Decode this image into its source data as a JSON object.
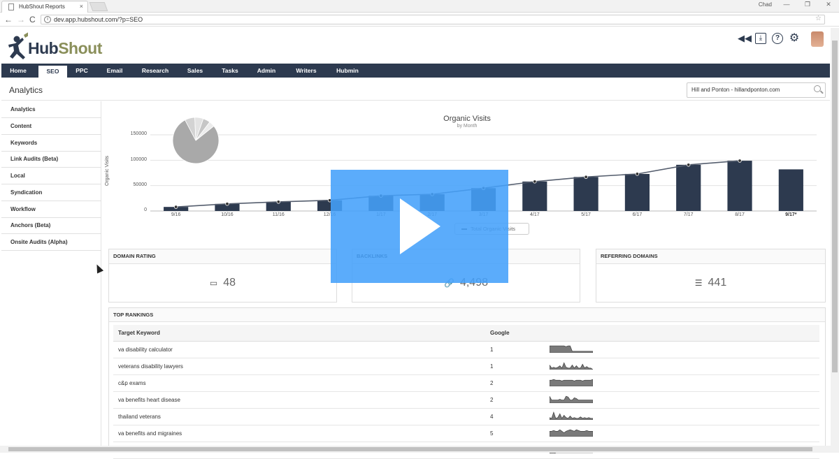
{
  "browser": {
    "tab_title": "HubShout Reports",
    "tab_close": "×",
    "user_badge": "Chad",
    "window_controls": [
      "—",
      "❐",
      "✕"
    ],
    "back_glyph": "←",
    "forward_glyph": "→",
    "reload_glyph": "C",
    "info_glyph": "i",
    "url": "dev.app.hubshout.com/?p=SEO",
    "star_glyph": "☆"
  },
  "app": {
    "logo_hub": "Hub",
    "logo_shout": "Shout",
    "header_icons": [
      "rewind-icon",
      "download-icon",
      "help-icon",
      "gear-icon"
    ],
    "header_glyphs": [
      "◀◀",
      "⤓",
      "?",
      "⚙"
    ]
  },
  "mainnav": [
    "Home",
    "SEO",
    "PPC",
    "Email",
    "Research",
    "Sales",
    "Tasks",
    "Admin",
    "Writers",
    "Hubmin"
  ],
  "mainnav_active": "SEO",
  "page": {
    "title": "Analytics",
    "site_search": "Hill and Ponton - hillandponton.com"
  },
  "sidebar": [
    "Analytics",
    "Content",
    "Keywords",
    "Link Audits (Beta)",
    "Local",
    "Syndication",
    "Workflow",
    "Anchors (Beta)",
    "Onsite Audits (Alpha)"
  ],
  "chart_data": {
    "type": "bar",
    "title": "Organic Visits",
    "subtitle": "by Month",
    "ylabel": "Organic Visits",
    "ylim": [
      0,
      150000
    ],
    "yticks": [
      "150000",
      "100000",
      "50000",
      "0"
    ],
    "categories": [
      "9/16",
      "10/16",
      "11/16",
      "12/16",
      "1/17",
      "2/17",
      "3/17",
      "4/17",
      "5/17",
      "6/17",
      "7/17",
      "8/17",
      "9/17*"
    ],
    "series": [
      {
        "values": [
          8000,
          14000,
          18000,
          21000,
          30000,
          33000,
          45000,
          58000,
          67000,
          73000,
          91000,
          99000,
          82000
        ]
      },
      {
        "name": "Total Organic Visits",
        "values": [
          8000,
          14000,
          18000,
          21000,
          30000,
          33000,
          45000,
          58000,
          67000,
          73000,
          91000,
          99000
        ]
      }
    ],
    "bar_color": "#2d3a4f",
    "line_color": "#555e6e",
    "grid": true
  },
  "pie": {
    "slices": [
      78,
      7,
      6,
      5,
      4
    ],
    "colors": [
      "#a9a9a9",
      "#d3d3d3",
      "#e3e3e3",
      "#c6c6c6",
      "#ececec"
    ]
  },
  "metrics": [
    {
      "label": "DOMAIN RATING",
      "icon": "battery-icon",
      "glyph": "▭",
      "value": "48"
    },
    {
      "label": "BACKLINKS",
      "icon": "link-icon",
      "glyph": "🔗",
      "value": "4,498"
    },
    {
      "label": "REFERRING DOMAINS",
      "icon": "lines-icon",
      "glyph": "☰",
      "value": "441"
    }
  ],
  "rankings": {
    "title": "TOP RANKINGS",
    "col_keyword": "Target Keyword",
    "col_google": "Google",
    "rows": [
      {
        "keyword": "va disability calculator",
        "google": "1",
        "spark": [
          9,
          9,
          9,
          9,
          9,
          9,
          9,
          9,
          8,
          9,
          9,
          2,
          2,
          2,
          2,
          2,
          2,
          2,
          2,
          2,
          2,
          2
        ]
      },
      {
        "keyword": "veterans disability lawyers",
        "google": "1",
        "spark": [
          6,
          2,
          3,
          2,
          3,
          5,
          2,
          9,
          3,
          2,
          2,
          6,
          2,
          5,
          2,
          2,
          7,
          2,
          4,
          2,
          2,
          0
        ]
      },
      {
        "keyword": "c&p exams",
        "google": "2",
        "spark": [
          8,
          8,
          9,
          8,
          8,
          8,
          7,
          8,
          8,
          8,
          8,
          8,
          7,
          8,
          8,
          8,
          7,
          8,
          8,
          8,
          8,
          9
        ]
      },
      {
        "keyword": "va benefits heart disease",
        "google": "2",
        "spark": [
          9,
          4,
          4,
          4,
          4,
          5,
          4,
          4,
          9,
          8,
          4,
          4,
          7,
          6,
          4,
          4,
          4,
          4,
          4,
          4,
          4,
          4
        ]
      },
      {
        "keyword": "thailand veterans",
        "google": "4",
        "spark": [
          3,
          2,
          10,
          2,
          3,
          8,
          2,
          6,
          3,
          2,
          5,
          2,
          3,
          2,
          2,
          4,
          2,
          3,
          2,
          3,
          2,
          2
        ]
      },
      {
        "keyword": "va benefits and migraines",
        "google": "5",
        "spark": [
          7,
          7,
          8,
          7,
          7,
          9,
          7,
          5,
          7,
          8,
          9,
          8,
          7,
          9,
          8,
          7,
          7,
          7,
          8,
          7,
          7,
          7
        ]
      },
      {
        "keyword": "",
        "google": "",
        "spark": [
          2,
          3,
          2,
          0,
          0,
          0,
          0,
          0,
          0,
          0,
          0,
          0,
          0,
          0,
          0,
          0,
          0,
          0,
          0,
          0,
          0,
          0
        ]
      }
    ]
  },
  "video_overlay": {
    "icon": "play-icon"
  }
}
